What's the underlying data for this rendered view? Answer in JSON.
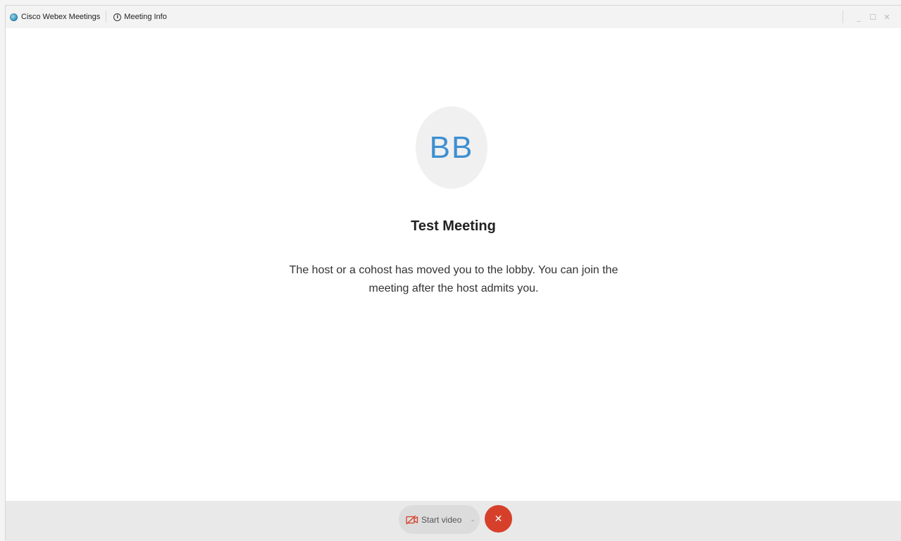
{
  "titlebar": {
    "app_title": "Cisco Webex Meetings",
    "meeting_info_label": "Meeting Info",
    "controls": {
      "minimize": "_",
      "maximize": "☐",
      "close": "✕"
    }
  },
  "lobby": {
    "avatar_initials": "BB",
    "meeting_title": "Test Meeting",
    "message": "The host or a cohost has moved you to the lobby. You can join the meeting after the host admits you."
  },
  "control_bar": {
    "start_video_label": "Start video",
    "chevron": "⌄",
    "leave_symbol": "✕"
  },
  "colors": {
    "accent": "#3d8fd1",
    "leave": "#d6402b",
    "video_off_icon": "#d6402b"
  },
  "icons": {
    "app_logo": "webex-logo-icon",
    "info": "info-icon",
    "video_off": "video-off-icon",
    "chevron": "chevron-down-icon",
    "leave": "close-icon"
  }
}
